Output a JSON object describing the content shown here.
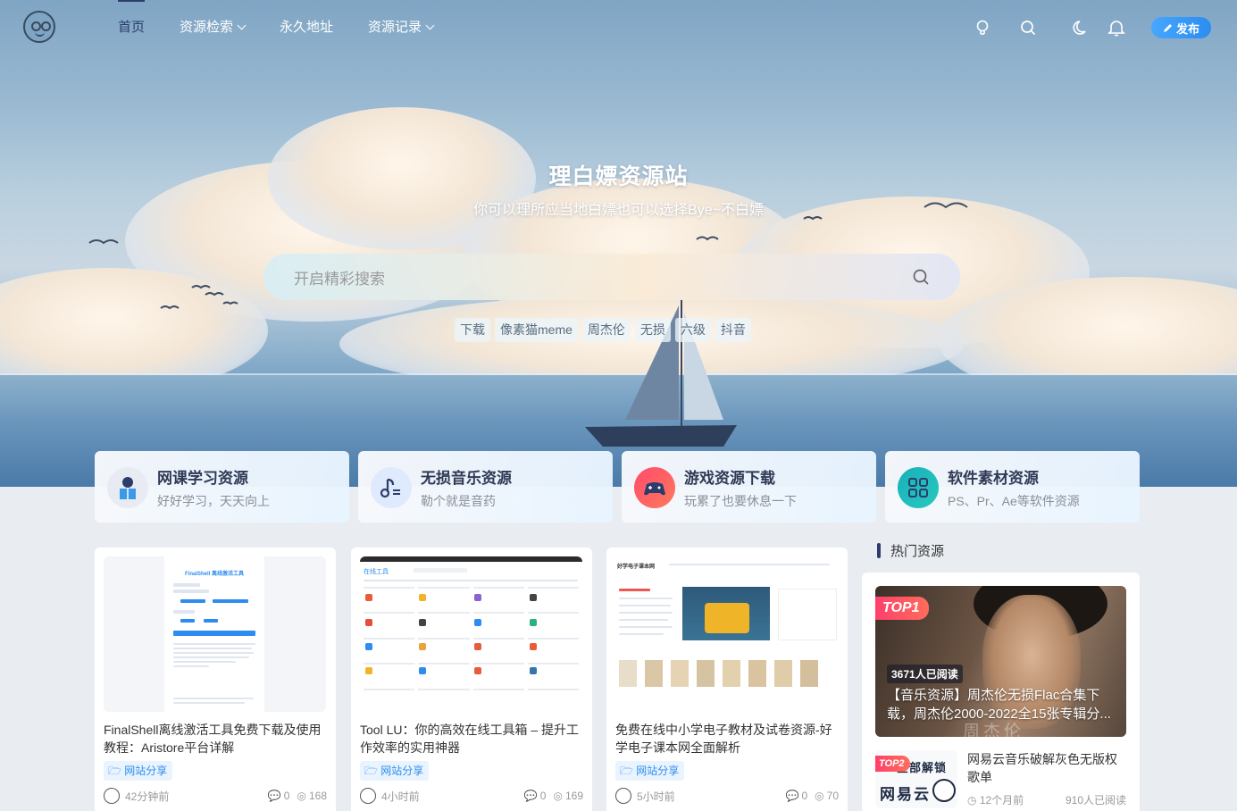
{
  "header": {
    "nav": [
      {
        "label": "首页",
        "active": true,
        "dropdown": false
      },
      {
        "label": "资源检索",
        "active": false,
        "dropdown": true
      },
      {
        "label": "永久地址",
        "active": false,
        "dropdown": false
      },
      {
        "label": "资源记录",
        "active": false,
        "dropdown": true
      }
    ],
    "icons": [
      "lightbulb-icon",
      "search-icon",
      "moon-icon",
      "bell-icon"
    ],
    "publish_label": "发布"
  },
  "hero": {
    "title": "理白嫖资源站",
    "subtitle": "你可以理所应当地白嫖也可以选择Bye~不白嫖",
    "search_placeholder": "开启精彩搜索",
    "hot_tags": [
      "下载",
      "像素猫meme",
      "周杰伦",
      "无损",
      "六级",
      "抖音"
    ]
  },
  "categories": [
    {
      "title": "网课学习资源",
      "desc": "好好学习，天天向上",
      "icon": "book-reader-icon",
      "color": "#e8ecf2"
    },
    {
      "title": "无损音乐资源",
      "desc": "勒个就是音药",
      "icon": "music-note-icon",
      "color": "#dfeaff"
    },
    {
      "title": "游戏资源下载",
      "desc": "玩累了也要休息一下",
      "icon": "gamepad-icon",
      "color": "#ff4a6e"
    },
    {
      "title": "软件素材资源",
      "desc": "PS、Pr、Ae等软件资源",
      "icon": "grid-apps-icon",
      "color": "#1cb5c0"
    }
  ],
  "posts": [
    {
      "title": "FinalShell离线激活工具免费下载及使用教程：Aristore平台详解",
      "category": "网站分享",
      "time": "42分钟前",
      "comments": "0",
      "views": "168",
      "thumb_title": "FinalShell 离线激活工具"
    },
    {
      "title": "Tool LU：你的高效在线工具箱 – 提升工作效率的实用神器",
      "category": "网站分享",
      "time": "4小时前",
      "comments": "0",
      "views": "169",
      "thumb_title": "在线工具"
    },
    {
      "title": "免费在线中小学电子教材及试卷资源-好学电子课本网全面解析",
      "category": "网站分享",
      "time": "5小时前",
      "comments": "0",
      "views": "70",
      "thumb_title": "好学电子课本网"
    }
  ],
  "sidebar": {
    "heading": "热门资源",
    "top1": {
      "badge": "TOP1",
      "reads": "3671人已阅读",
      "title": "【音乐资源】周杰伦无损Flac合集下载，周杰伦2000-2022全15张专辑分...",
      "watermark": "周杰伦"
    },
    "top2": {
      "badge": "TOP2",
      "thumb_line1": "全部解锁",
      "thumb_line2": "网易云",
      "title": "网易云音乐破解灰色无版权歌单",
      "time": "12个月前",
      "reads": "910人已阅读"
    }
  }
}
